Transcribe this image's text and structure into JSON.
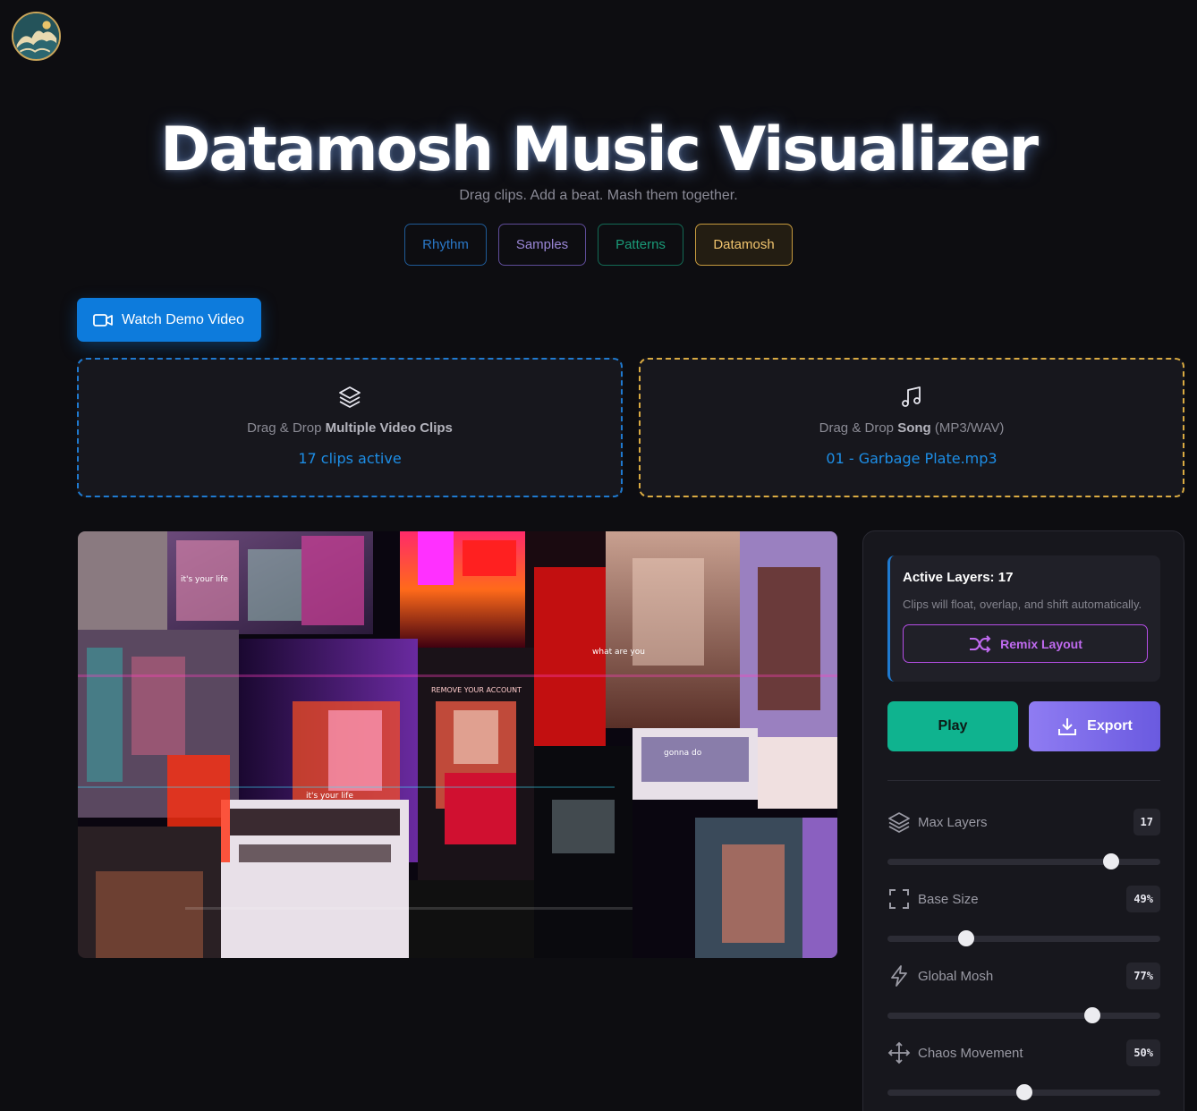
{
  "header": {
    "title": "Datamosh Music Visualizer",
    "subtitle": "Drag clips. Add a beat. Mash them together."
  },
  "nav": {
    "tabs": [
      {
        "label": "Rhythm"
      },
      {
        "label": "Samples"
      },
      {
        "label": "Patterns"
      },
      {
        "label": "Datamosh",
        "active": true
      }
    ]
  },
  "demo_button": {
    "label": "Watch Demo Video",
    "icon": "video-camera-icon"
  },
  "video_drop": {
    "prefix": "Drag & Drop ",
    "bold": "Multiple Video Clips",
    "status": "17 clips active",
    "icon": "layers-icon"
  },
  "audio_drop": {
    "prefix": "Drag & Drop ",
    "bold": "Song",
    "suffix": " (MP3/WAV)",
    "status": "01 - Garbage Plate.mp3",
    "icon": "music-note-icon"
  },
  "canvas": {
    "overlay_texts": [
      "it's your life",
      "what are you",
      "gonna do",
      "REMOVE YOUR ACCOUNT",
      "it's your life"
    ]
  },
  "panel": {
    "layers_title": "Active Layers: 17",
    "layers_desc": "Clips will float, overlap, and shift automatically.",
    "remix_label": "Remix Layout",
    "play_label": "Play",
    "export_label": "Export",
    "sliders": [
      {
        "label": "Max Layers",
        "display": "17",
        "fraction": 0.82,
        "icon": "layers-icon"
      },
      {
        "label": "Base Size",
        "display": "49%",
        "fraction": 0.29,
        "icon": "maximize-icon"
      },
      {
        "label": "Global Mosh",
        "display": "77%",
        "fraction": 0.75,
        "icon": "lightning-icon"
      },
      {
        "label": "Chaos Movement",
        "display": "50%",
        "fraction": 0.5,
        "icon": "move-arrows-icon"
      }
    ]
  },
  "colors": {
    "accent_blue": "#0d7bdc",
    "accent_gold": "#d9aa42",
    "play_green": "#0fb38f",
    "export_purple": "#7b6aea",
    "remix_magenta": "#b54ee6"
  }
}
